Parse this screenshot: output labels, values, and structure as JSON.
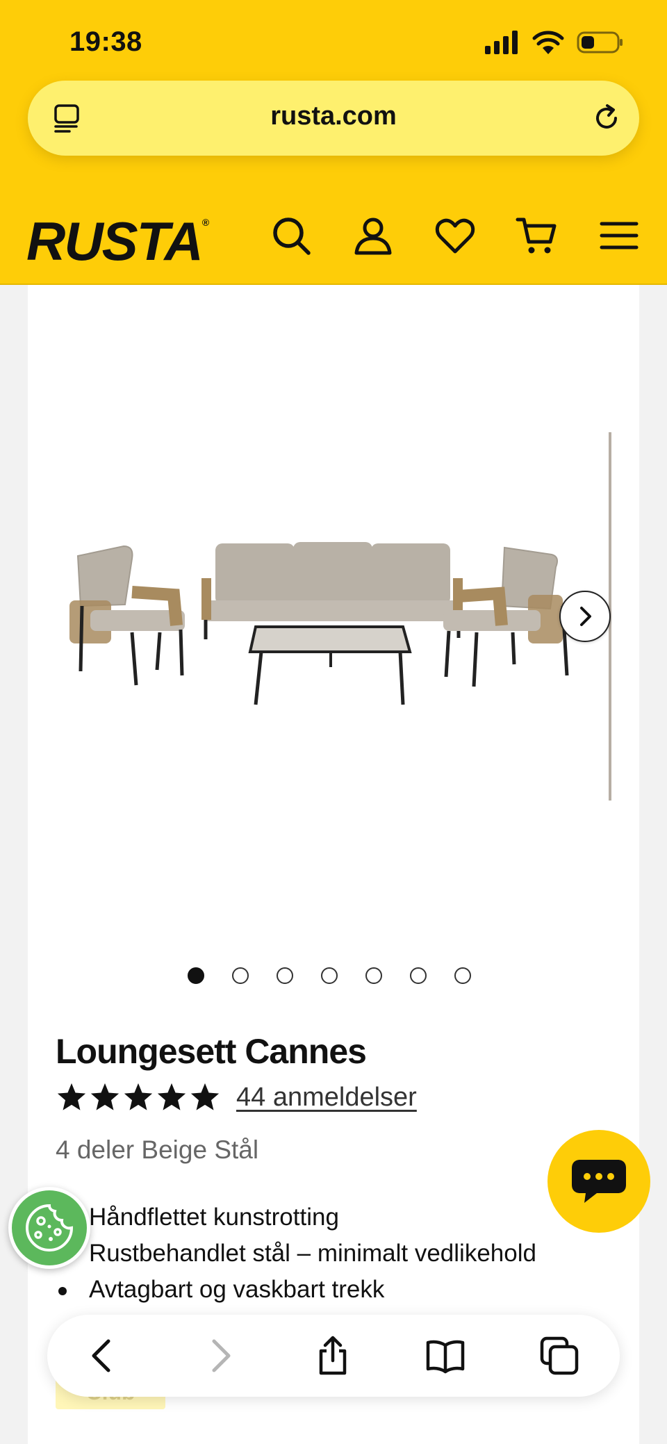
{
  "status_bar": {
    "time": "19:38"
  },
  "browser": {
    "url": "rusta.com"
  },
  "site": {
    "logo_text": "RUSTA",
    "logo_mark": "®"
  },
  "header_icons": [
    "search-icon",
    "user-icon",
    "heart-icon",
    "cart-icon",
    "menu-icon"
  ],
  "gallery": {
    "image_count": 7,
    "active_index": 0
  },
  "product": {
    "title": "Loungesett Cannes",
    "rating_stars": 5,
    "reviews_label": "44 anmeldelser",
    "variant": "4 deler Beige Stål",
    "features": [
      "Håndflettet kunstrotting",
      "Rustbehandlet stål – minimalt vedlikehold",
      "Avtagbart og vaskbart trekk"
    ],
    "club_label": "Club"
  },
  "colors": {
    "brand_yellow": "#fecd08",
    "url_bar": "#fef06e",
    "cookie_green": "#5cb85c",
    "text": "#111111"
  }
}
